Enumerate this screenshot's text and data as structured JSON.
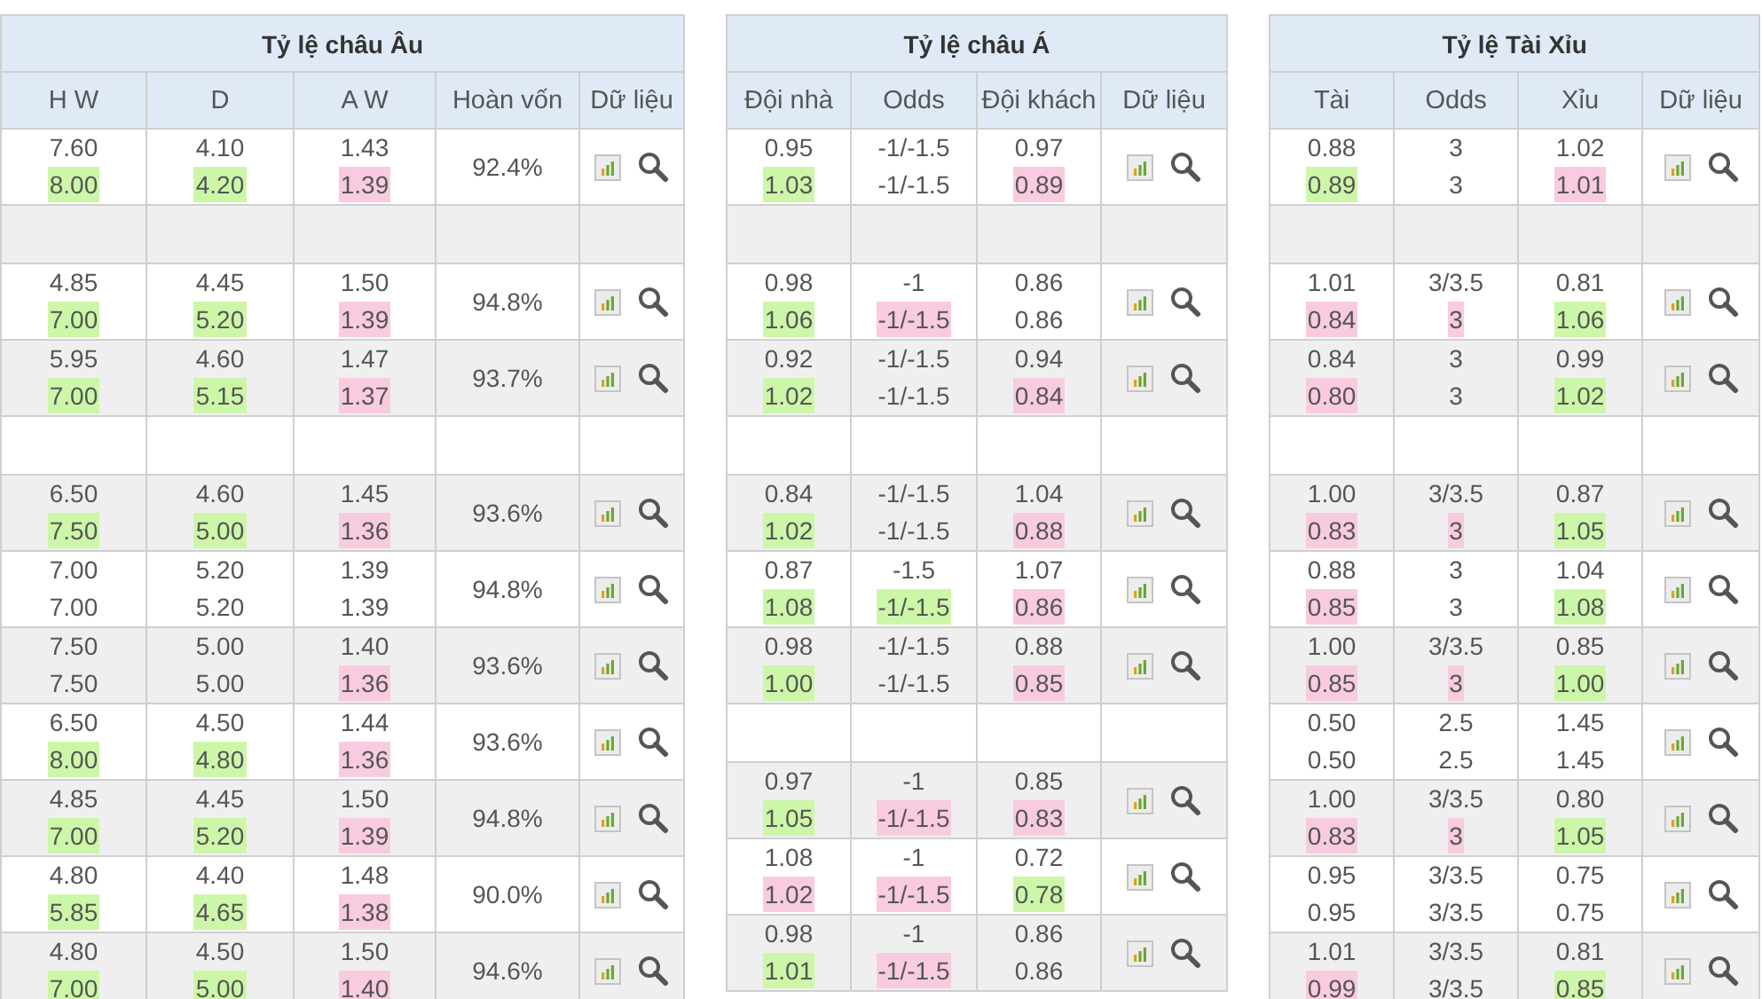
{
  "tables": [
    {
      "title": "Tỷ lệ châu Âu",
      "columns": [
        "H W",
        "D",
        "A W",
        "Hoàn vốn",
        "Dữ liệu"
      ],
      "rows": [
        {
          "kind": "odds",
          "cells": [
            [
              {
                "text": "7.60"
              },
              {
                "text": "8.00",
                "color": "#cdf7a8"
              }
            ],
            [
              {
                "text": "4.10"
              },
              {
                "text": "4.20",
                "color": "#cdf7a8"
              }
            ],
            [
              {
                "text": "1.43"
              },
              {
                "text": "1.39",
                "color": "#f8cbe0"
              }
            ],
            [
              {
                "text": "92.4%"
              }
            ]
          ]
        },
        {
          "kind": "empty"
        },
        {
          "kind": "odds",
          "cells": [
            [
              {
                "text": "4.85"
              },
              {
                "text": "7.00",
                "color": "#cdf7a8"
              }
            ],
            [
              {
                "text": "4.45"
              },
              {
                "text": "5.20",
                "color": "#cdf7a8"
              }
            ],
            [
              {
                "text": "1.50"
              },
              {
                "text": "1.39",
                "color": "#f8cbe0"
              }
            ],
            [
              {
                "text": "94.8%"
              }
            ]
          ]
        },
        {
          "kind": "odds",
          "cells": [
            [
              {
                "text": "5.95"
              },
              {
                "text": "7.00",
                "color": "#cdf7a8"
              }
            ],
            [
              {
                "text": "4.60"
              },
              {
                "text": "5.15",
                "color": "#cdf7a8"
              }
            ],
            [
              {
                "text": "1.47"
              },
              {
                "text": "1.37",
                "color": "#f8cbe0"
              }
            ],
            [
              {
                "text": "93.7%"
              }
            ]
          ]
        },
        {
          "kind": "empty"
        },
        {
          "kind": "odds",
          "cells": [
            [
              {
                "text": "6.50"
              },
              {
                "text": "7.50",
                "color": "#cdf7a8"
              }
            ],
            [
              {
                "text": "4.60"
              },
              {
                "text": "5.00",
                "color": "#cdf7a8"
              }
            ],
            [
              {
                "text": "1.45"
              },
              {
                "text": "1.36",
                "color": "#f8cbe0"
              }
            ],
            [
              {
                "text": "93.6%"
              }
            ]
          ]
        },
        {
          "kind": "odds",
          "cells": [
            [
              {
                "text": "7.00"
              },
              {
                "text": "7.00"
              }
            ],
            [
              {
                "text": "5.20"
              },
              {
                "text": "5.20"
              }
            ],
            [
              {
                "text": "1.39"
              },
              {
                "text": "1.39"
              }
            ],
            [
              {
                "text": "94.8%"
              }
            ]
          ]
        },
        {
          "kind": "odds",
          "cells": [
            [
              {
                "text": "7.50"
              },
              {
                "text": "7.50"
              }
            ],
            [
              {
                "text": "5.00"
              },
              {
                "text": "5.00"
              }
            ],
            [
              {
                "text": "1.40"
              },
              {
                "text": "1.36",
                "color": "#f8cbe0"
              }
            ],
            [
              {
                "text": "93.6%"
              }
            ]
          ]
        },
        {
          "kind": "odds",
          "cells": [
            [
              {
                "text": "6.50"
              },
              {
                "text": "8.00",
                "color": "#cdf7a8"
              }
            ],
            [
              {
                "text": "4.50"
              },
              {
                "text": "4.80",
                "color": "#cdf7a8"
              }
            ],
            [
              {
                "text": "1.44"
              },
              {
                "text": "1.36",
                "color": "#f8cbe0"
              }
            ],
            [
              {
                "text": "93.6%"
              }
            ]
          ]
        },
        {
          "kind": "odds",
          "cells": [
            [
              {
                "text": "4.85"
              },
              {
                "text": "7.00",
                "color": "#cdf7a8"
              }
            ],
            [
              {
                "text": "4.45"
              },
              {
                "text": "5.20",
                "color": "#cdf7a8"
              }
            ],
            [
              {
                "text": "1.50"
              },
              {
                "text": "1.39",
                "color": "#f8cbe0"
              }
            ],
            [
              {
                "text": "94.8%"
              }
            ]
          ]
        },
        {
          "kind": "odds",
          "cells": [
            [
              {
                "text": "4.80"
              },
              {
                "text": "5.85",
                "color": "#cdf7a8"
              }
            ],
            [
              {
                "text": "4.40"
              },
              {
                "text": "4.65",
                "color": "#cdf7a8"
              }
            ],
            [
              {
                "text": "1.48"
              },
              {
                "text": "1.38",
                "color": "#f8cbe0"
              }
            ],
            [
              {
                "text": "90.0%"
              }
            ]
          ]
        },
        {
          "kind": "odds",
          "cells": [
            [
              {
                "text": "4.80"
              },
              {
                "text": "7.00",
                "color": "#cdf7a8"
              }
            ],
            [
              {
                "text": "4.50"
              },
              {
                "text": "5.00",
                "color": "#cdf7a8"
              }
            ],
            [
              {
                "text": "1.50"
              },
              {
                "text": "1.40",
                "color": "#f8cbe0"
              }
            ],
            [
              {
                "text": "94.6%"
              }
            ]
          ]
        }
      ]
    },
    {
      "title": "Tỷ lệ châu Á",
      "columns": [
        "Đội nhà",
        "Odds",
        "Đội khách",
        "Dữ liệu"
      ],
      "rows": [
        {
          "kind": "odds",
          "cells": [
            [
              {
                "text": "0.95"
              },
              {
                "text": "1.03",
                "color": "#cdf7a8"
              }
            ],
            [
              {
                "text": "-1/-1.5"
              },
              {
                "text": "-1/-1.5"
              }
            ],
            [
              {
                "text": "0.97"
              },
              {
                "text": "0.89",
                "color": "#f8cbe0"
              }
            ]
          ]
        },
        {
          "kind": "empty"
        },
        {
          "kind": "odds",
          "cells": [
            [
              {
                "text": "0.98"
              },
              {
                "text": "1.06",
                "color": "#cdf7a8"
              }
            ],
            [
              {
                "text": "-1"
              },
              {
                "text": "-1/-1.5",
                "color": "#f8cbe0"
              }
            ],
            [
              {
                "text": "0.86"
              },
              {
                "text": "0.86"
              }
            ]
          ]
        },
        {
          "kind": "odds",
          "cells": [
            [
              {
                "text": "0.92"
              },
              {
                "text": "1.02",
                "color": "#cdf7a8"
              }
            ],
            [
              {
                "text": "-1/-1.5"
              },
              {
                "text": "-1/-1.5"
              }
            ],
            [
              {
                "text": "0.94"
              },
              {
                "text": "0.84",
                "color": "#f8cbe0"
              }
            ]
          ]
        },
        {
          "kind": "empty"
        },
        {
          "kind": "odds",
          "cells": [
            [
              {
                "text": "0.84"
              },
              {
                "text": "1.02",
                "color": "#cdf7a8"
              }
            ],
            [
              {
                "text": "-1/-1.5"
              },
              {
                "text": "-1/-1.5"
              }
            ],
            [
              {
                "text": "1.04"
              },
              {
                "text": "0.88",
                "color": "#f8cbe0"
              }
            ]
          ]
        },
        {
          "kind": "odds",
          "cells": [
            [
              {
                "text": "0.87"
              },
              {
                "text": "1.08",
                "color": "#cdf7a8"
              }
            ],
            [
              {
                "text": "-1.5"
              },
              {
                "text": "-1/-1.5",
                "color": "#cdf7a8"
              }
            ],
            [
              {
                "text": "1.07"
              },
              {
                "text": "0.86",
                "color": "#f8cbe0"
              }
            ]
          ]
        },
        {
          "kind": "odds",
          "cells": [
            [
              {
                "text": "0.98"
              },
              {
                "text": "1.00",
                "color": "#cdf7a8"
              }
            ],
            [
              {
                "text": "-1/-1.5"
              },
              {
                "text": "-1/-1.5"
              }
            ],
            [
              {
                "text": "0.88"
              },
              {
                "text": "0.85",
                "color": "#f8cbe0"
              }
            ]
          ]
        },
        {
          "kind": "empty"
        },
        {
          "kind": "odds",
          "cells": [
            [
              {
                "text": "0.97"
              },
              {
                "text": "1.05",
                "color": "#cdf7a8"
              }
            ],
            [
              {
                "text": "-1"
              },
              {
                "text": "-1/-1.5",
                "color": "#f8cbe0"
              }
            ],
            [
              {
                "text": "0.85"
              },
              {
                "text": "0.83",
                "color": "#f8cbe0"
              }
            ]
          ]
        },
        {
          "kind": "odds",
          "cells": [
            [
              {
                "text": "1.08"
              },
              {
                "text": "1.02",
                "color": "#f8cbe0"
              }
            ],
            [
              {
                "text": "-1"
              },
              {
                "text": "-1/-1.5",
                "color": "#f8cbe0"
              }
            ],
            [
              {
                "text": "0.72"
              },
              {
                "text": "0.78",
                "color": "#cdf7a8"
              }
            ]
          ]
        },
        {
          "kind": "odds",
          "cells": [
            [
              {
                "text": "0.98"
              },
              {
                "text": "1.01",
                "color": "#cdf7a8"
              }
            ],
            [
              {
                "text": "-1"
              },
              {
                "text": "-1/-1.5",
                "color": "#f8cbe0"
              }
            ],
            [
              {
                "text": "0.86"
              },
              {
                "text": "0.86"
              }
            ]
          ]
        }
      ]
    },
    {
      "title": "Tỷ lệ Tài Xỉu",
      "columns": [
        "Tài",
        "Odds",
        "Xỉu",
        "Dữ liệu"
      ],
      "rows": [
        {
          "kind": "odds",
          "cells": [
            [
              {
                "text": "0.88"
              },
              {
                "text": "0.89",
                "color": "#cdf7a8"
              }
            ],
            [
              {
                "text": "3"
              },
              {
                "text": "3"
              }
            ],
            [
              {
                "text": "1.02"
              },
              {
                "text": "1.01",
                "color": "#f8cbe0"
              }
            ]
          ]
        },
        {
          "kind": "empty"
        },
        {
          "kind": "odds",
          "cells": [
            [
              {
                "text": "1.01"
              },
              {
                "text": "0.84",
                "color": "#f8cbe0"
              }
            ],
            [
              {
                "text": "3/3.5"
              },
              {
                "text": "3",
                "color": "#f8cbe0"
              }
            ],
            [
              {
                "text": "0.81"
              },
              {
                "text": "1.06",
                "color": "#cdf7a8"
              }
            ]
          ]
        },
        {
          "kind": "odds",
          "cells": [
            [
              {
                "text": "0.84"
              },
              {
                "text": "0.80",
                "color": "#f8cbe0"
              }
            ],
            [
              {
                "text": "3"
              },
              {
                "text": "3"
              }
            ],
            [
              {
                "text": "0.99"
              },
              {
                "text": "1.02",
                "color": "#cdf7a8"
              }
            ]
          ]
        },
        {
          "kind": "empty"
        },
        {
          "kind": "odds",
          "cells": [
            [
              {
                "text": "1.00"
              },
              {
                "text": "0.83",
                "color": "#f8cbe0"
              }
            ],
            [
              {
                "text": "3/3.5"
              },
              {
                "text": "3",
                "color": "#f8cbe0"
              }
            ],
            [
              {
                "text": "0.87"
              },
              {
                "text": "1.05",
                "color": "#cdf7a8"
              }
            ]
          ]
        },
        {
          "kind": "odds",
          "cells": [
            [
              {
                "text": "0.88"
              },
              {
                "text": "0.85",
                "color": "#f8cbe0"
              }
            ],
            [
              {
                "text": "3"
              },
              {
                "text": "3"
              }
            ],
            [
              {
                "text": "1.04"
              },
              {
                "text": "1.08",
                "color": "#cdf7a8"
              }
            ]
          ]
        },
        {
          "kind": "odds",
          "cells": [
            [
              {
                "text": "1.00"
              },
              {
                "text": "0.85",
                "color": "#f8cbe0"
              }
            ],
            [
              {
                "text": "3/3.5"
              },
              {
                "text": "3",
                "color": "#f8cbe0"
              }
            ],
            [
              {
                "text": "0.85"
              },
              {
                "text": "1.00",
                "color": "#cdf7a8"
              }
            ]
          ]
        },
        {
          "kind": "odds",
          "cells": [
            [
              {
                "text": "0.50"
              },
              {
                "text": "0.50"
              }
            ],
            [
              {
                "text": "2.5"
              },
              {
                "text": "2.5"
              }
            ],
            [
              {
                "text": "1.45"
              },
              {
                "text": "1.45"
              }
            ]
          ]
        },
        {
          "kind": "odds",
          "cells": [
            [
              {
                "text": "1.00"
              },
              {
                "text": "0.83",
                "color": "#f8cbe0"
              }
            ],
            [
              {
                "text": "3/3.5"
              },
              {
                "text": "3",
                "color": "#f8cbe0"
              }
            ],
            [
              {
                "text": "0.80"
              },
              {
                "text": "1.05",
                "color": "#cdf7a8"
              }
            ]
          ]
        },
        {
          "kind": "odds",
          "cells": [
            [
              {
                "text": "0.95"
              },
              {
                "text": "0.95"
              }
            ],
            [
              {
                "text": "3/3.5"
              },
              {
                "text": "3/3.5"
              }
            ],
            [
              {
                "text": "0.75"
              },
              {
                "text": "0.75"
              }
            ]
          ]
        },
        {
          "kind": "odds",
          "cells": [
            [
              {
                "text": "1.01"
              },
              {
                "text": "0.99",
                "color": "#f8cbe0"
              }
            ],
            [
              {
                "text": "3/3.5"
              },
              {
                "text": "3/3.5"
              }
            ],
            [
              {
                "text": "0.81"
              },
              {
                "text": "0.85",
                "color": "#cdf7a8"
              }
            ]
          ]
        }
      ]
    }
  ]
}
